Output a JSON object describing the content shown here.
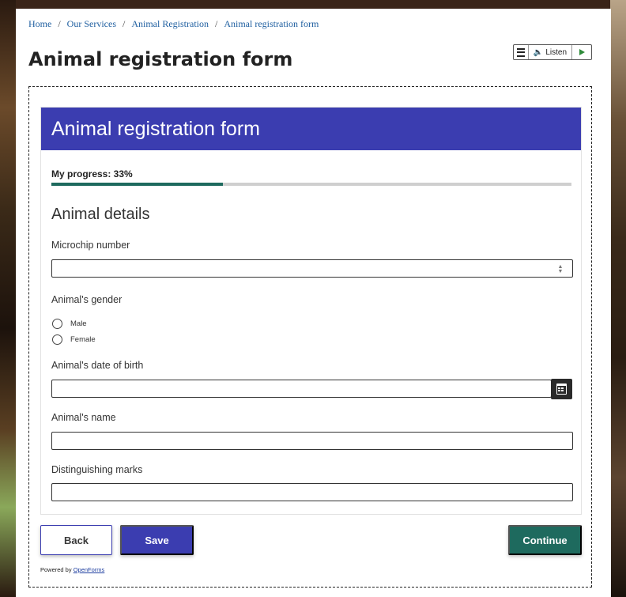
{
  "breadcrumb": {
    "items": [
      "Home",
      "Our Services",
      "Animal Registration",
      "Animal registration form"
    ],
    "separator": "/"
  },
  "page": {
    "title": "Animal registration form"
  },
  "listen_widget": {
    "label": "Listen",
    "icons": [
      "menu-icon",
      "speaker-icon",
      "play-icon"
    ]
  },
  "form": {
    "header": "Animal registration form",
    "progress": {
      "label": "My progress: 33%",
      "fraction": 0.33
    },
    "section_title": "Animal details",
    "fields": {
      "microchip": {
        "label": "Microchip number",
        "value": ""
      },
      "gender": {
        "label": "Animal's gender",
        "options": [
          "Male",
          "Female"
        ]
      },
      "dob": {
        "label": "Animal's date of birth",
        "value": ""
      },
      "name": {
        "label": "Animal's name",
        "value": ""
      },
      "marks": {
        "label": "Distinguishing marks",
        "value": ""
      }
    }
  },
  "buttons": {
    "back": "Back",
    "save": "Save",
    "continue": "Continue"
  },
  "footer": {
    "powered_prefix": "Powered by",
    "powered_link": "OpenForms"
  },
  "colors": {
    "header_bg": "#3b3db0",
    "progress_fill": "#1e6a5e",
    "continue_bg": "#1e6a5e",
    "link": "#1f5fa0"
  }
}
